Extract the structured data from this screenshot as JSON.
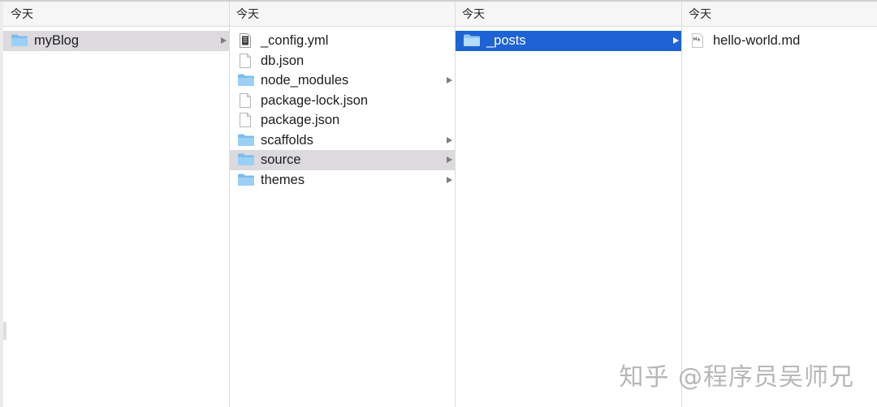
{
  "columns": [
    {
      "header": "今天",
      "items": [
        {
          "name": "myBlog",
          "kind": "folder",
          "has_children": true,
          "state": "selected-inactive"
        }
      ]
    },
    {
      "header": "今天",
      "items": [
        {
          "name": "_config.yml",
          "kind": "yml-file",
          "has_children": false,
          "state": "normal"
        },
        {
          "name": "db.json",
          "kind": "file",
          "has_children": false,
          "state": "normal"
        },
        {
          "name": "node_modules",
          "kind": "folder",
          "has_children": true,
          "state": "normal"
        },
        {
          "name": "package-lock.json",
          "kind": "file",
          "has_children": false,
          "state": "normal"
        },
        {
          "name": "package.json",
          "kind": "file",
          "has_children": false,
          "state": "normal"
        },
        {
          "name": "scaffolds",
          "kind": "folder",
          "has_children": true,
          "state": "normal"
        },
        {
          "name": "source",
          "kind": "folder",
          "has_children": true,
          "state": "selected-inactive"
        },
        {
          "name": "themes",
          "kind": "folder",
          "has_children": true,
          "state": "normal"
        }
      ]
    },
    {
      "header": "今天",
      "items": [
        {
          "name": "_posts",
          "kind": "folder",
          "has_children": true,
          "state": "selected-active"
        }
      ]
    },
    {
      "header": "今天",
      "items": [
        {
          "name": "hello-world.md",
          "kind": "md-file",
          "has_children": false,
          "state": "normal"
        }
      ]
    }
  ],
  "watermark": "知乎 @程序员吴师兄",
  "colors": {
    "selection_active": "#1d63d5",
    "selection_inactive": "#dcdadd",
    "folder": "#8cc8f2"
  }
}
